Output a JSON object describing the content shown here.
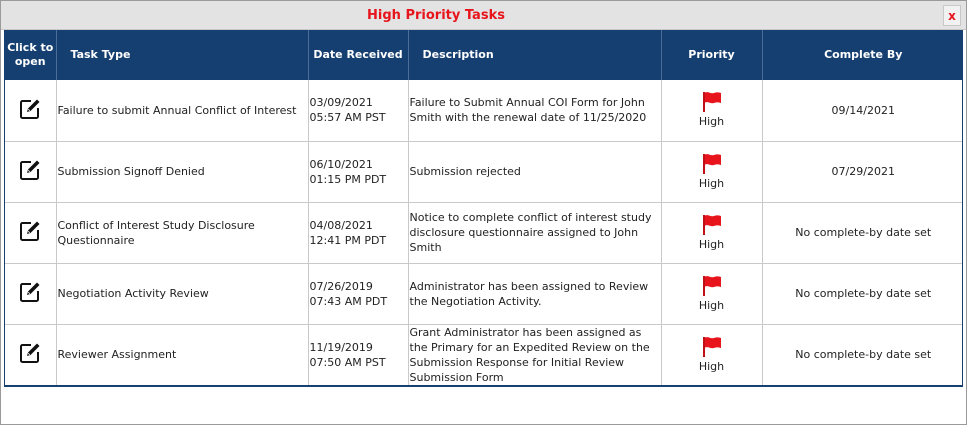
{
  "dialog": {
    "title": "High Priority Tasks",
    "close_label": "x"
  },
  "colors": {
    "title": "#e8141c",
    "header_bg": "#163f71",
    "flag": "#e8141c"
  },
  "table": {
    "headers": {
      "click_to_open_line1": "Click to",
      "click_to_open_line2": "open",
      "task_type": "Task Type",
      "date_received": "Date Received",
      "description": "Description",
      "priority": "Priority",
      "complete_by": "Complete By"
    },
    "rows": [
      {
        "task_type": "Failure to submit Annual Conflict of Interest",
        "date": "03/09/2021",
        "time": "05:57 AM PST",
        "description": "Failure to Submit Annual COI Form for John Smith with the renewal date of 11/25/2020",
        "priority": "High",
        "complete_by": "09/14/2021"
      },
      {
        "task_type": "Submission Signoff Denied",
        "date": "06/10/2021",
        "time": "01:15 PM PDT",
        "description": "Submission rejected",
        "priority": "High",
        "complete_by": "07/29/2021"
      },
      {
        "task_type": "Conflict of Interest Study Disclosure Questionnaire",
        "date": "04/08/2021",
        "time": "12:41 PM PDT",
        "description": "Notice to complete conflict of interest study disclosure questionnaire assigned to John Smith",
        "priority": "High",
        "complete_by": "No complete-by date set"
      },
      {
        "task_type": "Negotiation Activity Review",
        "date": "07/26/2019",
        "time": "07:43 AM PDT",
        "description": "Administrator has been assigned to Review the Negotiation Activity.",
        "priority": "High",
        "complete_by": "No complete-by date set"
      },
      {
        "task_type": "Reviewer Assignment",
        "date": "11/19/2019",
        "time": "07:50 AM PST",
        "description": "Grant Administrator has been assigned as the Primary for an Expedited Review on the Submission Response for Initial Review Submission Form",
        "priority": "High",
        "complete_by": "No complete-by date set"
      }
    ]
  }
}
